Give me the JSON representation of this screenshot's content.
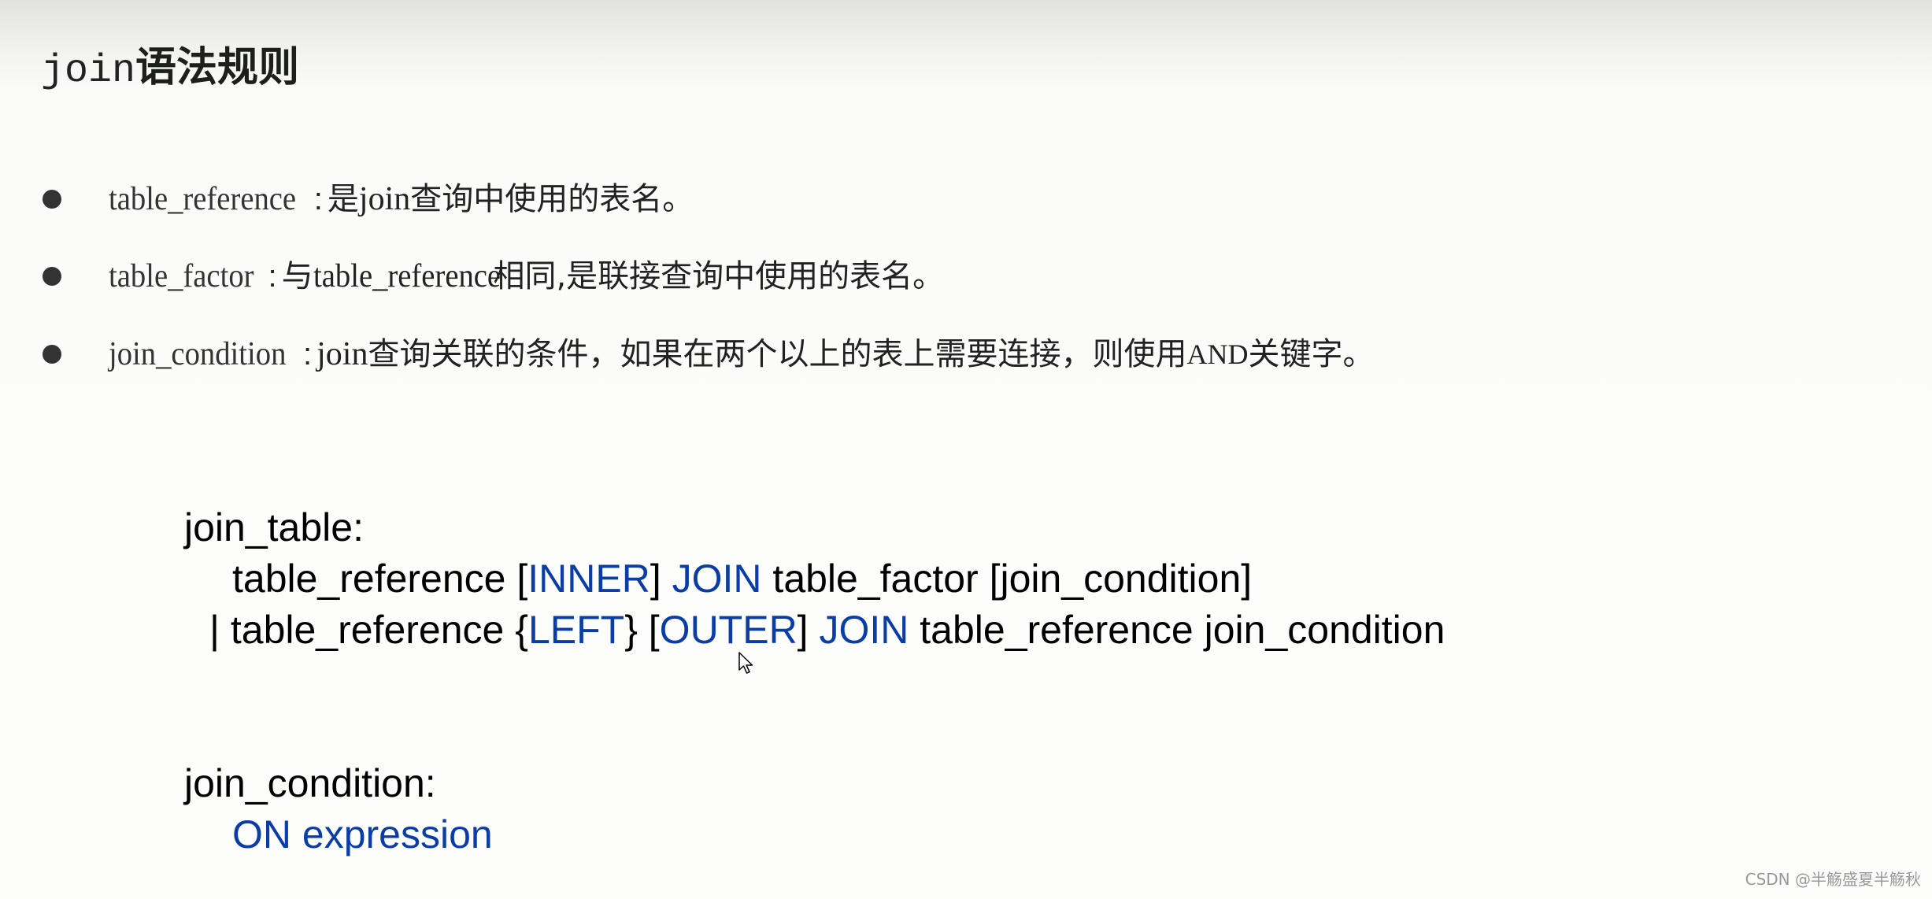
{
  "title": {
    "mono": "join",
    "cjk": "语法规则"
  },
  "bullets": [
    {
      "term": "table_reference",
      "sep": ":",
      "parts": [
        "是",
        "join",
        "查询中使用的表名。"
      ]
    },
    {
      "term": "table_factor",
      "sep": ":",
      "parts": [
        "与",
        "table_reference",
        "相同,是联接查询中使用的表名。"
      ]
    },
    {
      "term": "join_condition",
      "sep": ":",
      "parts": [
        "join",
        "查询关联的条件，如果在两个以上的表上需要连接，则使用",
        "AND",
        "关键字。"
      ]
    }
  ],
  "syntax": {
    "join_table_label": "join_table:",
    "line1": {
      "a": "table_reference [",
      "k1": "INNER",
      "b": "] ",
      "k2": "JOIN",
      "c": " table_factor [join_condition]"
    },
    "line2": {
      "a": "| table_reference {",
      "k1": "LEFT",
      "b": "} [",
      "k2": "OUTER",
      "c": "] ",
      "k3": "JOIN",
      "d": " table_reference join_condition"
    },
    "join_condition_label": "join_condition:",
    "on_expression": "ON expression"
  },
  "colors": {
    "keyword": "#0a3ea6",
    "text": "#000000"
  },
  "watermark": "CSDN @半觞盛夏半觞秋"
}
